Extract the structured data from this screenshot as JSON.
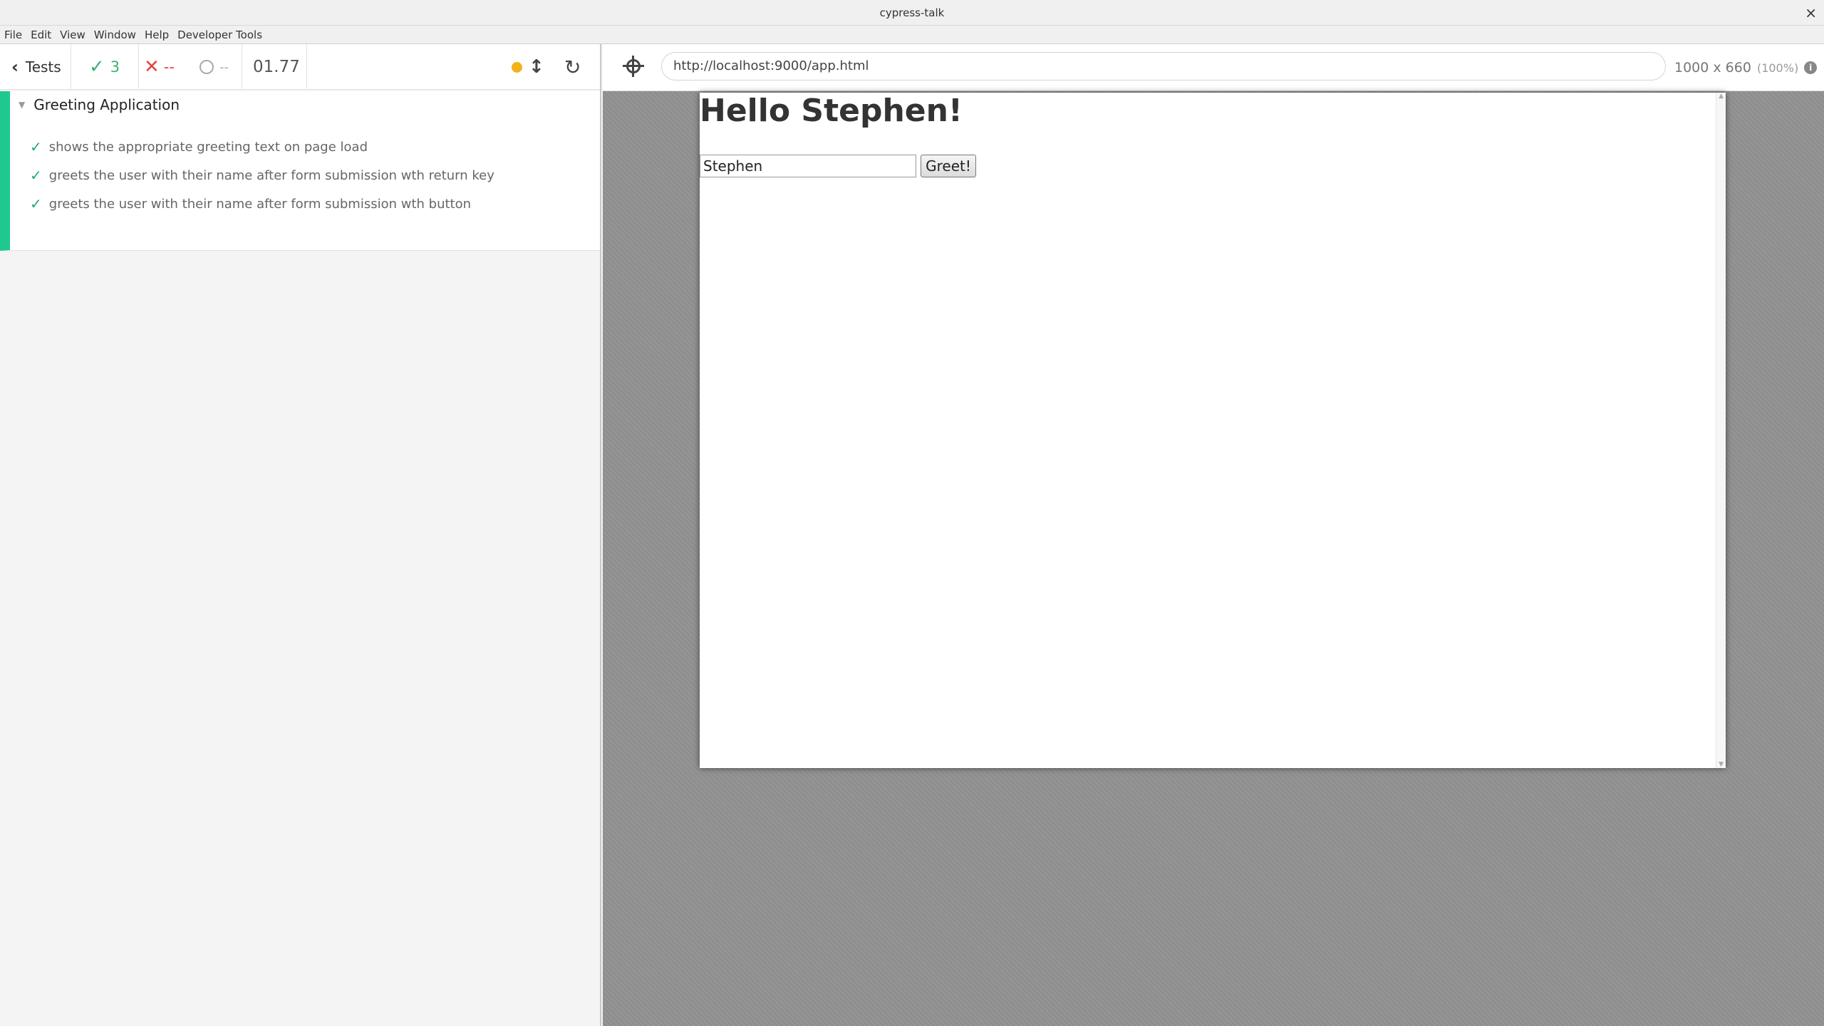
{
  "window": {
    "title": "cypress-talk",
    "close_glyph": "×"
  },
  "menu": [
    "File",
    "Edit",
    "View",
    "Window",
    "Help",
    "Developer Tools"
  ],
  "reporter": {
    "back_label": "Tests",
    "passed": "3",
    "failed": "--",
    "pending": "--",
    "duration": "01.77",
    "suite": "Greeting Application",
    "tests": [
      "shows the appropriate greeting text on page load",
      "greets the user with their name after form submission wth return key",
      "greets the user with their name after form submission wth button"
    ],
    "colors": {
      "passed": "#1ec88e",
      "failed": "#e5443f",
      "running": "#f2b31a"
    }
  },
  "aut": {
    "url": "http://localhost:9000/app.html",
    "viewport_size": "1000 x 660",
    "viewport_scale": "(100%)"
  },
  "app": {
    "heading": "Hello Stephen!",
    "input_value": "Stephen",
    "button_label": "Greet!"
  }
}
